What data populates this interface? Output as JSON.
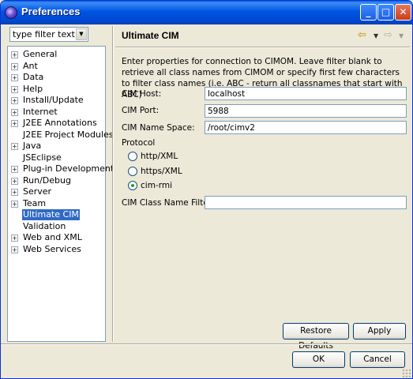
{
  "window": {
    "title": "Preferences"
  },
  "filter": {
    "text": "type filter text"
  },
  "tree": [
    {
      "label": "General",
      "expandable": true,
      "selected": false
    },
    {
      "label": "Ant",
      "expandable": true,
      "selected": false
    },
    {
      "label": "Data",
      "expandable": true,
      "selected": false
    },
    {
      "label": "Help",
      "expandable": true,
      "selected": false
    },
    {
      "label": "Install/Update",
      "expandable": true,
      "selected": false
    },
    {
      "label": "Internet",
      "expandable": true,
      "selected": false
    },
    {
      "label": "J2EE Annotations",
      "expandable": true,
      "selected": false
    },
    {
      "label": "J2EE Project Modules",
      "expandable": false,
      "selected": false
    },
    {
      "label": "Java",
      "expandable": true,
      "selected": false
    },
    {
      "label": "JSEclipse",
      "expandable": false,
      "selected": false
    },
    {
      "label": "Plug-in Development",
      "expandable": true,
      "selected": false
    },
    {
      "label": "Run/Debug",
      "expandable": true,
      "selected": false
    },
    {
      "label": "Server",
      "expandable": true,
      "selected": false
    },
    {
      "label": "Team",
      "expandable": true,
      "selected": false
    },
    {
      "label": "Ultimate CIM",
      "expandable": false,
      "selected": true
    },
    {
      "label": "Validation",
      "expandable": false,
      "selected": false
    },
    {
      "label": "Web and XML",
      "expandable": true,
      "selected": false
    },
    {
      "label": "Web Services",
      "expandable": true,
      "selected": false
    }
  ],
  "page": {
    "title": "Ultimate CIM",
    "description": "Enter properties for connection to CIMOM. Leave filter blank to retrieve all class names from CIMOM or specify first few characters to filter class names (i.e. ABC - return all classnames that start with ABC)"
  },
  "fields": {
    "host_label": "CIM Host:",
    "host_value": "localhost",
    "port_label": "CIM Port:",
    "port_value": "5988",
    "namespace_label": "CIM Name Space:",
    "namespace_value": "/root/cimv2",
    "filter_label": "CIM Class Name Filter:",
    "filter_value": ""
  },
  "protocol": {
    "label": "Protocol",
    "options": [
      {
        "label": "http/XML",
        "checked": false
      },
      {
        "label": "https/XML",
        "checked": false
      },
      {
        "label": "cim-rmi",
        "checked": true
      }
    ]
  },
  "buttons": {
    "restore_defaults": "Restore Defaults",
    "apply": "Apply",
    "ok": "OK",
    "cancel": "Cancel"
  },
  "icons": {
    "app": "eclipse-icon",
    "minimize": "minimize-icon",
    "maximize": "maximize-icon",
    "close": "close-icon",
    "back": "back-arrow-icon",
    "forward": "forward-arrow-icon"
  }
}
